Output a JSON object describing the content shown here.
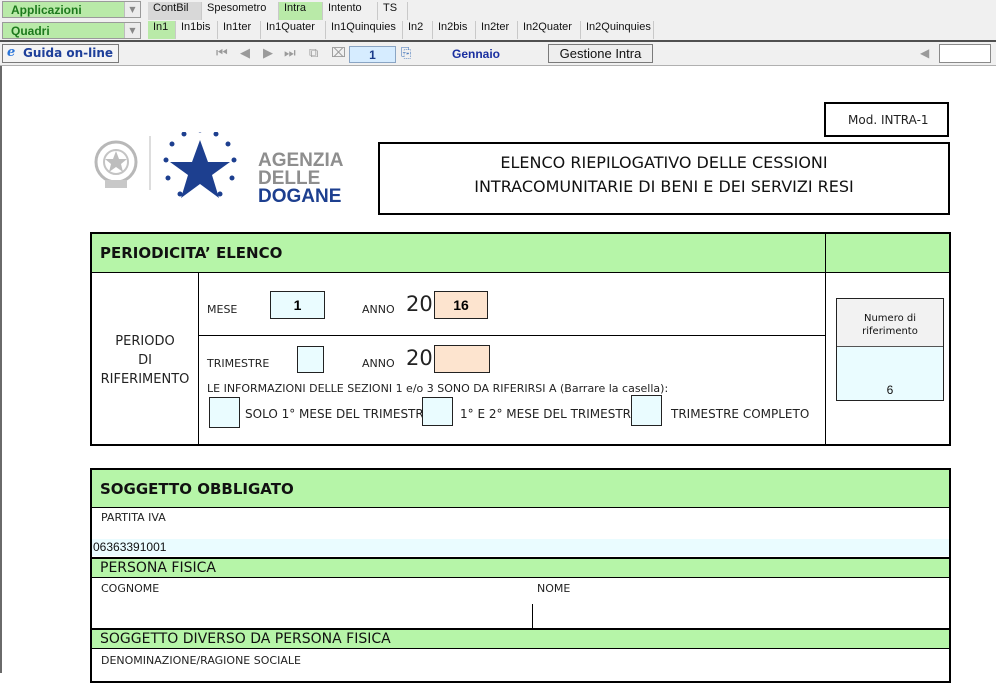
{
  "topbar": {
    "applicazioni": "Applicazioni",
    "quadri": "Quadri",
    "tabs_top": [
      {
        "label": "ContBil"
      },
      {
        "label": "Spesometro"
      },
      {
        "label": "Intra"
      },
      {
        "label": "Intento"
      },
      {
        "label": "TS"
      }
    ],
    "tabs_sub": [
      {
        "label": "In1"
      },
      {
        "label": "In1bis"
      },
      {
        "label": "In1ter"
      },
      {
        "label": "In1Quater"
      },
      {
        "label": "In1Quinquies"
      },
      {
        "label": "In2"
      },
      {
        "label": "In2bis"
      },
      {
        "label": "In2ter"
      },
      {
        "label": "In2Quater"
      },
      {
        "label": "In2Quinquies"
      }
    ]
  },
  "toolbar": {
    "help_label": "Guida on-line",
    "page": "1",
    "month": "Gennaio",
    "gestione_label": "Gestione Intra"
  },
  "form": {
    "model": "Mod. INTRA-1",
    "logo_text": [
      "AGENZIA",
      "DELLE",
      "DOGANE"
    ],
    "title_line1": "ELENCO RIEPILOGATIVO DELLE CESSIONI",
    "title_line2": "INTRACOMUNITARIE DI BENI E DEI SERVIZI RESI",
    "periodicita": "PERIODICITA’ ELENCO",
    "periodo": [
      "PERIODO",
      "DI",
      "RIFERIMENTO"
    ],
    "mese_label": "MESE",
    "mese_value": "1",
    "anno_label": "ANNO",
    "anno_prefix": "20",
    "anno_value": "16",
    "trimestre_label": "TRIMESTRE",
    "anno2_label": "ANNO",
    "anno2_prefix": "20",
    "info_text": "LE INFORMAZIONI DELLE SEZIONI 1 e/o 3 SONO DA RIFERIRSI A (Barrare la casella):",
    "opt1": "SOLO 1° MESE DEL TRIMESTRE",
    "opt2": "1° E 2° MESE DEL TRIMESTRE",
    "opt3": "TRIMESTRE   COMPLETO",
    "numero_label": "Numero di riferimento",
    "numero_value": "6",
    "soggetto": "SOGGETTO OBBLIGATO",
    "partita_iva_label": "PARTITA IVA",
    "partita_iva_value": "06363391001",
    "persona_fisica": "PERSONA FISICA",
    "cognome": "COGNOME",
    "nome": "NOME",
    "soggetto_diverso": "SOGGETTO DIVERSO DA PERSONA FISICA",
    "denominazione": "DENOMINAZIONE/RAGIONE SOCIALE"
  }
}
